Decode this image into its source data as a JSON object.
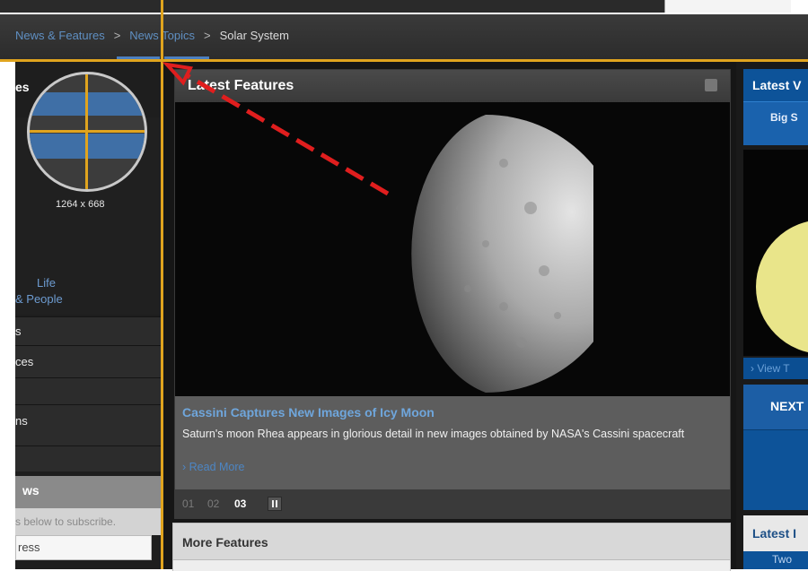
{
  "breadcrumb": {
    "items": [
      "News & Features",
      "News Topics",
      "Solar System"
    ],
    "separator": ">"
  },
  "left_sidebar": {
    "title_fragment": "es",
    "magnifier_label": "1264 x 668",
    "links": [
      "Life",
      "& People"
    ],
    "menu_fragments": [
      "s",
      "ces",
      "ns"
    ],
    "news_heading_fragment": "ws",
    "subscribe_text": "s below to subscribe.",
    "address_fragment": "ress"
  },
  "main": {
    "feature_title": "Latest Features",
    "caption_title": "Cassini Captures New Images of Icy Moon",
    "caption_text": "Saturn's moon Rhea appears in glorious detail in new images obtained by NASA's Cassini spacecraft",
    "read_more": "› Read More",
    "pager": [
      "01",
      "02",
      "03"
    ],
    "pager_active": "03",
    "more_features": "More Features"
  },
  "right_sidebar": {
    "heading_fragment": "Latest V",
    "button_fragment": "Big S",
    "view_fragment": "› View T",
    "next_fragment": "NEXT",
    "latest2_fragment": "Latest I",
    "two_fragment": "Two"
  },
  "colors": {
    "guide_line": "#e0a41e",
    "arrow": "#e01e1e",
    "link_blue": "#6fa6dc",
    "brand_blue": "#0d5399"
  }
}
